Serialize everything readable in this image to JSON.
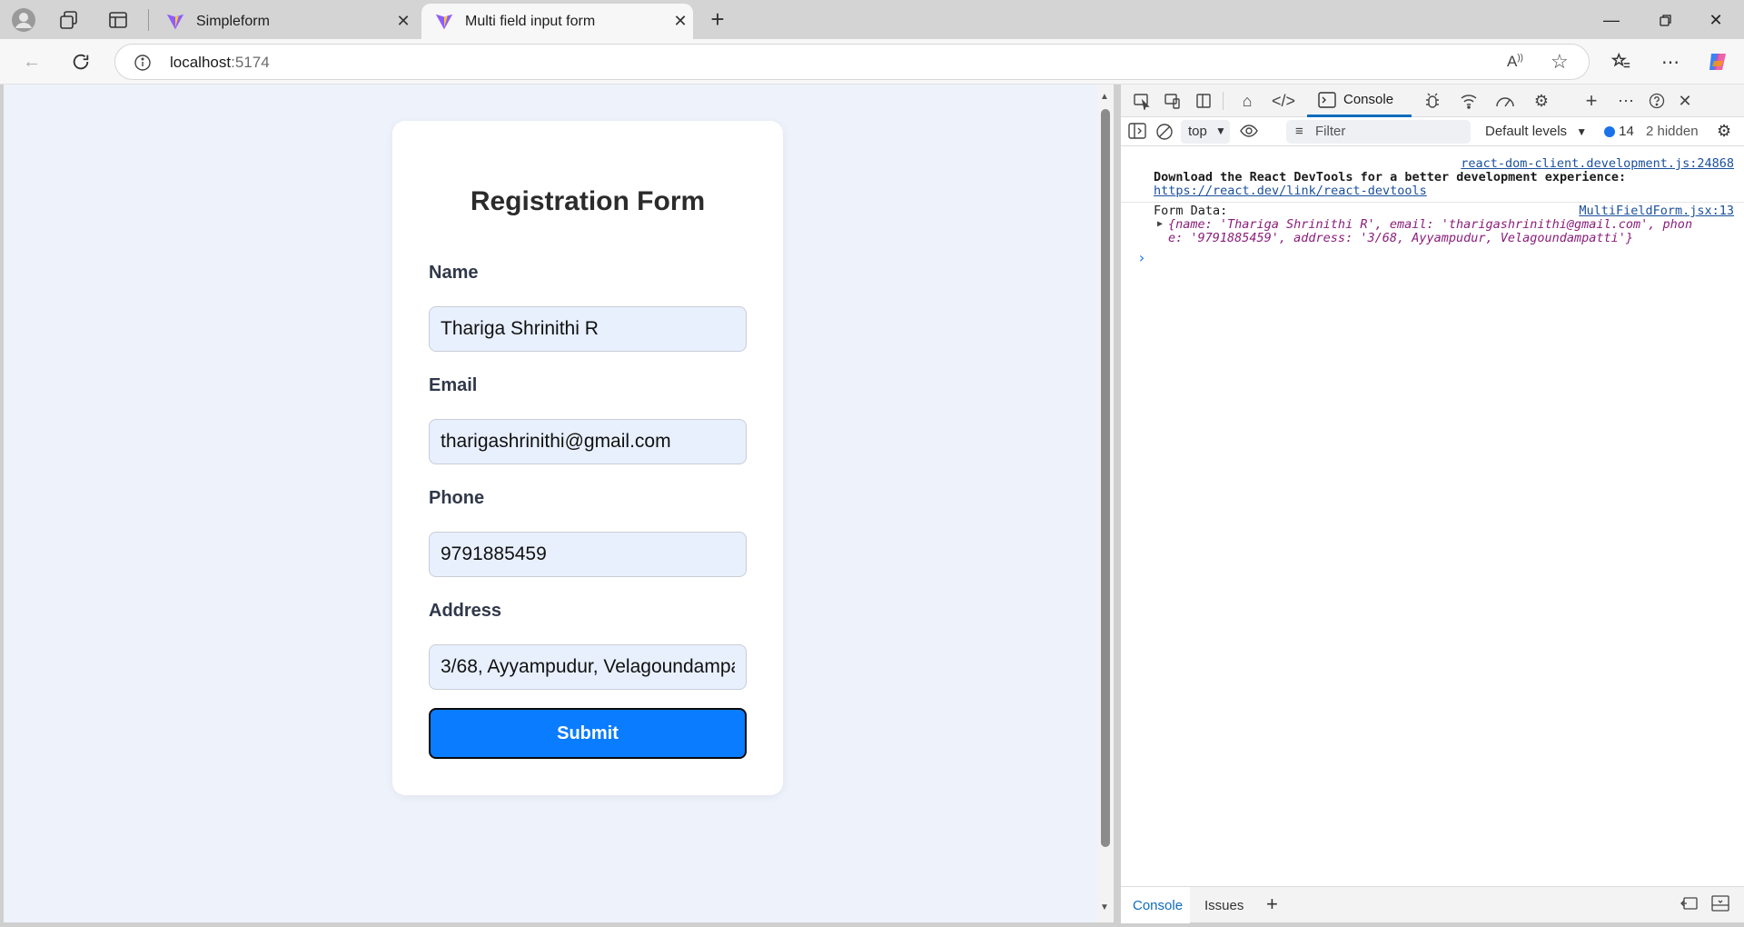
{
  "browser": {
    "tabs": [
      {
        "title": "Simpleform"
      },
      {
        "title": "Multi field input form"
      }
    ],
    "address": {
      "host": "localhost",
      "port": ":5174"
    }
  },
  "form": {
    "title": "Registration Form",
    "fields": [
      {
        "label": "Name",
        "value": "Thariga Shrinithi R"
      },
      {
        "label": "Email",
        "value": "tharigashrinithi@gmail.com"
      },
      {
        "label": "Phone",
        "value": "9791885459"
      },
      {
        "label": "Address",
        "value": "3/68, Ayyampudur, Velagoundampatti"
      }
    ],
    "submit_label": "Submit"
  },
  "devtools": {
    "active_tab": "Console",
    "context": "top",
    "filter_placeholder": "Filter",
    "levels": "Default levels",
    "issue_count": "14",
    "hidden": "2 hidden",
    "messages": [
      {
        "source": "react-dom-client.development.js:24868",
        "text": "Download the React DevTools for a better development experience:",
        "link": "https://react.dev/link/react-devtools"
      },
      {
        "source": "MultiFieldForm.jsx:13",
        "text": "Form Data:",
        "object_line1": "{name: 'Thariga Shrinithi R', email: 'tharigashrinithi@gmail.com', phon",
        "object_line2": "e: '9791885459', address: '3/68, Ayyampudur, Velagoundampatti'}"
      }
    ],
    "bottom_tabs": [
      "Console",
      "Issues"
    ]
  }
}
